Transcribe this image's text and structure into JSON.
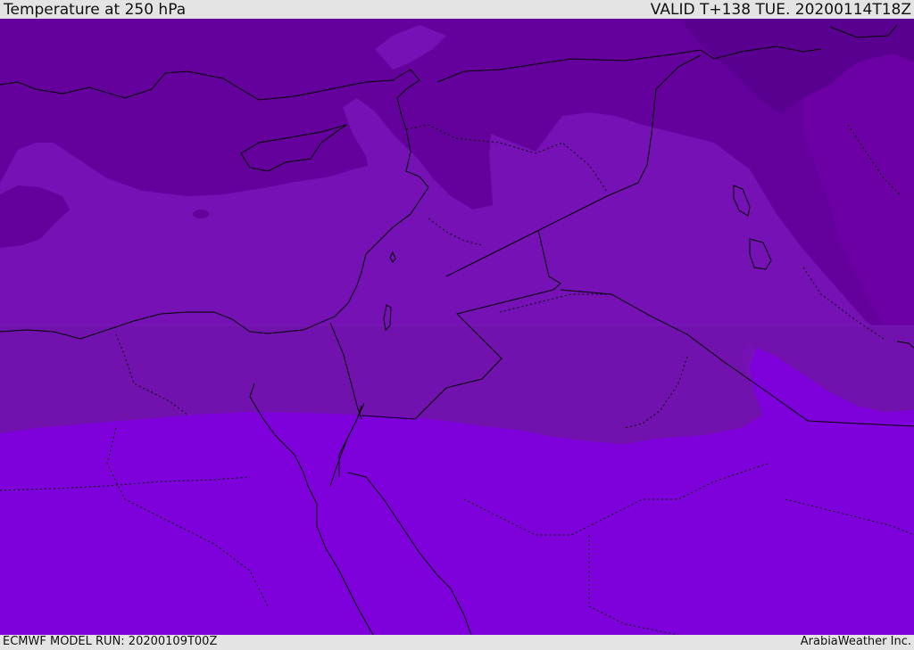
{
  "header": {
    "title": "Temperature at 250 hPa",
    "valid": "VALID T+138 TUE. 20200114T18Z"
  },
  "footer": {
    "model_run": "ECMWF MODEL RUN: 20200109T00Z",
    "credit": "ArabiaWeather Inc."
  },
  "colors": {
    "bar_background": "#e4e4e4",
    "darkest_band": "#5a0090",
    "dark_band": "#64009b",
    "mid_dark_band": "#6c00a4",
    "mid_band": "#7511b5",
    "light_band": "#7e00da",
    "coastline": "#000000"
  }
}
